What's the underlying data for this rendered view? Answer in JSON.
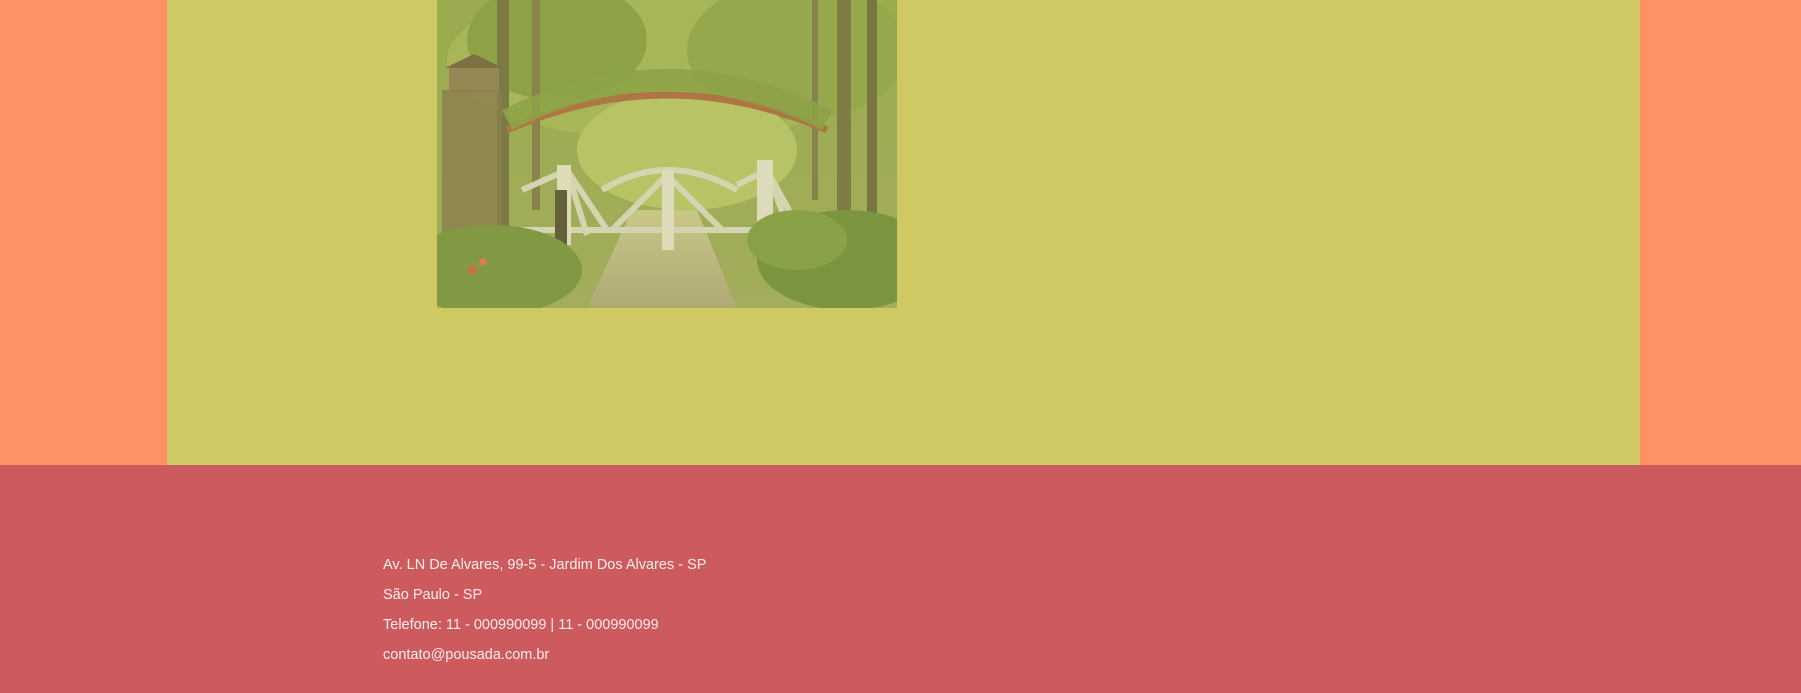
{
  "gallery": {
    "image": {
      "subject": "garden gate under a leafy arch",
      "icon": "photo-image"
    }
  },
  "footer": {
    "address": "Av. LN De Alvares, 99-5 - Jardim Dos Alvares - SP",
    "city": "São Paulo - SP",
    "phone": "Telefone: 11 - 000990099 | 11 - 000990099",
    "email": "contato@pousada.com.br"
  },
  "colors": {
    "page_background": "#ff9166",
    "content_background": "#cfc963",
    "footer_background": "#cd5b5e",
    "footer_text": "#f6ecec"
  }
}
